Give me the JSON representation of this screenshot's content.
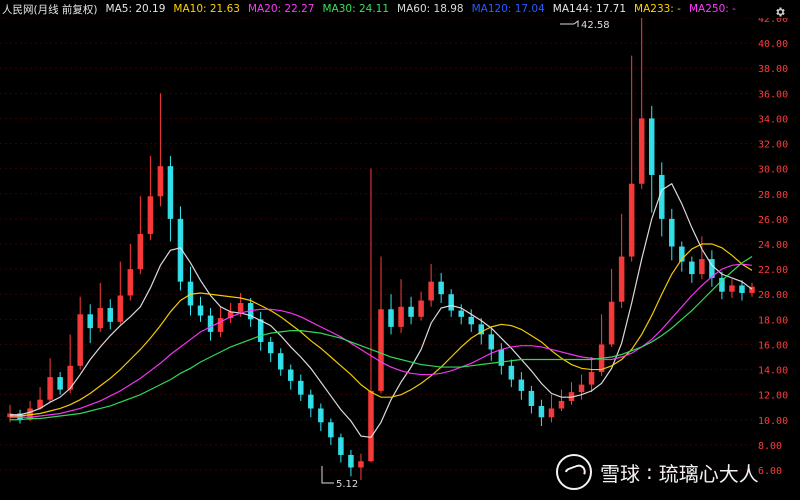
{
  "toolbar": {
    "title": "人民网(月线 前复权)",
    "ma": [
      {
        "label": "MA5: 20.19",
        "color": "#e6e6e6"
      },
      {
        "label": "MA10: 21.63",
        "color": "#ffd400"
      },
      {
        "label": "MA20: 22.27",
        "color": "#ff37ff"
      },
      {
        "label": "MA30: 24.11",
        "color": "#34e35a"
      },
      {
        "label": "MA60: 18.98",
        "color": "#d9d9d9"
      },
      {
        "label": "MA120: 17.04",
        "color": "#2b59ff"
      },
      {
        "label": "MA144: 17.71",
        "color": "#e6e6e6"
      },
      {
        "label": "MA233: -",
        "color": "#ffd400"
      },
      {
        "label": "MA250: -",
        "color": "#ff37ff"
      }
    ],
    "settings_icon": "settings-icon"
  },
  "y_axis": {
    "ticks": [
      "42.00",
      "40.00",
      "38.00",
      "36.00",
      "34.00",
      "32.00",
      "30.00",
      "28.00",
      "26.00",
      "24.00",
      "22.00",
      "20.00",
      "18.00",
      "16.00",
      "14.00",
      "12.00",
      "10.00",
      "8.00",
      "6.00"
    ]
  },
  "annotations": {
    "high": "42.58",
    "low": "5.12"
  },
  "watermark": {
    "brand": "雪球",
    "sep": ":",
    "author": "琉璃心大人"
  },
  "chart_data": {
    "type": "candlestick",
    "y_range": [
      6.0,
      42.0
    ],
    "colors": {
      "up": "#ff3b3b",
      "down": "#35e6ef",
      "ma5": "#e6e6e6",
      "ma10": "#ffd400",
      "ma20": "#ff37ff",
      "ma30": "#34e35a",
      "ma60": "#d9d9d9",
      "ma120": "#2b59ff",
      "ma144": "#e6e6e6",
      "ma233": "#ffd400",
      "ma250": "#ff37ff"
    },
    "candles": [
      [
        10.2,
        10.5,
        11.2,
        9.8
      ],
      [
        10.5,
        10.0,
        10.8,
        9.7
      ],
      [
        10.0,
        10.9,
        11.5,
        9.9
      ],
      [
        10.9,
        11.6,
        12.6,
        10.8
      ],
      [
        11.6,
        13.4,
        14.9,
        11.4
      ],
      [
        13.4,
        12.4,
        13.8,
        12.0
      ],
      [
        12.4,
        14.3,
        16.8,
        12.1
      ],
      [
        14.3,
        18.4,
        19.8,
        14.0
      ],
      [
        18.4,
        17.3,
        19.2,
        16.1
      ],
      [
        17.3,
        18.9,
        20.9,
        17.0
      ],
      [
        18.9,
        17.8,
        19.6,
        17.2
      ],
      [
        17.8,
        19.9,
        22.6,
        17.6
      ],
      [
        19.9,
        22.0,
        24.0,
        19.5
      ],
      [
        22.0,
        24.8,
        27.8,
        21.6
      ],
      [
        24.8,
        27.8,
        31.0,
        24.3
      ],
      [
        27.8,
        30.2,
        36.0,
        27.0
      ],
      [
        30.2,
        26.0,
        31.0,
        24.2
      ],
      [
        26.0,
        21.0,
        27.0,
        20.3
      ],
      [
        21.0,
        19.1,
        22.2,
        18.3
      ],
      [
        19.1,
        18.3,
        19.8,
        17.8
      ],
      [
        18.3,
        17.0,
        18.9,
        16.3
      ],
      [
        17.0,
        18.1,
        19.0,
        16.6
      ],
      [
        18.1,
        18.6,
        19.3,
        17.7
      ],
      [
        18.6,
        19.3,
        20.1,
        18.2
      ],
      [
        19.3,
        18.0,
        19.7,
        17.4
      ],
      [
        18.0,
        16.2,
        18.6,
        15.5
      ],
      [
        16.2,
        15.3,
        16.6,
        14.6
      ],
      [
        15.3,
        14.0,
        15.7,
        13.5
      ],
      [
        14.0,
        13.1,
        14.4,
        12.4
      ],
      [
        13.1,
        12.0,
        13.6,
        11.5
      ],
      [
        12.0,
        10.9,
        12.4,
        10.2
      ],
      [
        10.9,
        9.8,
        11.3,
        9.1
      ],
      [
        9.8,
        8.6,
        10.1,
        8.0
      ],
      [
        8.6,
        7.2,
        8.9,
        6.6
      ],
      [
        7.2,
        6.2,
        7.6,
        5.5
      ],
      [
        6.2,
        6.7,
        7.3,
        5.2
      ],
      [
        6.7,
        12.3,
        30.0,
        6.6
      ],
      [
        12.3,
        18.8,
        23.0,
        12.1
      ],
      [
        18.8,
        17.4,
        20.0,
        16.8
      ],
      [
        17.4,
        19.0,
        21.2,
        16.9
      ],
      [
        19.0,
        18.2,
        19.8,
        17.6
      ],
      [
        18.2,
        19.5,
        20.2,
        17.9
      ],
      [
        19.5,
        21.0,
        22.4,
        19.0
      ],
      [
        21.0,
        20.0,
        21.7,
        19.3
      ],
      [
        20.0,
        18.7,
        20.4,
        18.2
      ],
      [
        18.7,
        18.2,
        19.2,
        17.6
      ],
      [
        18.2,
        17.6,
        18.8,
        17.0
      ],
      [
        17.6,
        16.8,
        18.1,
        16.0
      ],
      [
        16.8,
        15.6,
        17.3,
        14.7
      ],
      [
        15.6,
        14.3,
        16.1,
        13.6
      ],
      [
        14.3,
        13.2,
        14.8,
        12.6
      ],
      [
        13.2,
        12.3,
        13.8,
        11.6
      ],
      [
        12.3,
        11.1,
        12.7,
        10.5
      ],
      [
        11.1,
        10.2,
        11.6,
        9.5
      ],
      [
        10.2,
        10.9,
        12.0,
        9.8
      ],
      [
        10.9,
        11.5,
        12.4,
        10.7
      ],
      [
        11.5,
        12.2,
        13.0,
        11.2
      ],
      [
        12.2,
        12.8,
        13.6,
        11.6
      ],
      [
        12.8,
        13.8,
        15.0,
        12.2
      ],
      [
        13.8,
        16.0,
        18.4,
        13.5
      ],
      [
        16.0,
        19.4,
        22.0,
        15.8
      ],
      [
        19.4,
        23.0,
        26.4,
        18.9
      ],
      [
        23.0,
        28.8,
        39.0,
        22.6
      ],
      [
        28.8,
        34.0,
        42.6,
        28.4
      ],
      [
        34.0,
        29.5,
        35.0,
        26.5
      ],
      [
        29.5,
        26.0,
        30.5,
        24.6
      ],
      [
        26.0,
        23.8,
        26.8,
        22.7
      ],
      [
        23.8,
        22.6,
        24.2,
        21.8
      ],
      [
        22.6,
        21.6,
        23.0,
        20.9
      ],
      [
        21.6,
        22.8,
        24.6,
        21.2
      ],
      [
        22.8,
        21.3,
        23.5,
        20.6
      ],
      [
        21.3,
        20.2,
        21.8,
        19.6
      ],
      [
        20.2,
        20.7,
        21.2,
        19.7
      ],
      [
        20.7,
        20.1,
        21.1,
        19.5
      ],
      [
        20.1,
        20.6,
        20.9,
        19.8
      ]
    ],
    "ma": {
      "ma5": [
        10.4,
        10.4,
        10.6,
        10.9,
        11.4,
        11.8,
        12.5,
        13.6,
        14.8,
        15.8,
        16.7,
        17.5,
        18.2,
        19.0,
        20.5,
        22.3,
        23.5,
        23.7,
        22.5,
        21.1,
        19.9,
        19.0,
        18.6,
        18.5,
        18.3,
        17.9,
        17.5,
        16.7,
        15.8,
        15.0,
        14.1,
        13.0,
        11.9,
        10.8,
        9.9,
        8.7,
        8.6,
        9.8,
        11.6,
        13.0,
        14.2,
        15.6,
        17.7,
        18.9,
        19.1,
        18.9,
        18.4,
        17.9,
        17.3,
        16.5,
        15.7,
        14.8,
        13.9,
        12.9,
        12.1,
        11.8,
        11.8,
        12.0,
        12.3,
        12.9,
        14.1,
        16.1,
        19.3,
        22.8,
        26.0,
        28.3,
        28.8,
        27.2,
        25.3,
        23.6,
        22.3,
        21.6,
        21.3,
        21.0,
        20.4
      ],
      "ma10": [
        10.3,
        10.3,
        10.4,
        10.5,
        10.7,
        10.9,
        11.2,
        11.6,
        12.1,
        12.7,
        13.3,
        14.0,
        14.8,
        15.6,
        16.5,
        17.5,
        18.6,
        19.5,
        20.0,
        20.1,
        20.0,
        19.9,
        19.8,
        19.7,
        19.5,
        19.1,
        18.7,
        18.2,
        17.6,
        17.0,
        16.3,
        15.7,
        15.0,
        14.3,
        13.6,
        12.8,
        12.2,
        11.8,
        11.8,
        12.0,
        12.4,
        12.9,
        13.5,
        14.2,
        15.0,
        15.8,
        16.5,
        17.0,
        17.4,
        17.6,
        17.5,
        17.2,
        16.7,
        16.2,
        15.5,
        14.9,
        14.4,
        14.1,
        14.0,
        14.0,
        14.3,
        14.8,
        15.6,
        16.8,
        18.3,
        20.0,
        21.6,
        22.8,
        23.6,
        24.0,
        24.0,
        23.7,
        23.1,
        22.4,
        21.9
      ],
      "ma20": [
        10.2,
        10.2,
        10.2,
        10.3,
        10.4,
        10.5,
        10.7,
        10.9,
        11.2,
        11.5,
        11.9,
        12.3,
        12.8,
        13.3,
        13.9,
        14.5,
        15.2,
        15.8,
        16.4,
        17.0,
        17.4,
        17.8,
        18.2,
        18.5,
        18.7,
        18.8,
        18.8,
        18.7,
        18.5,
        18.2,
        17.8,
        17.4,
        17.0,
        16.6,
        16.1,
        15.6,
        15.1,
        14.6,
        14.2,
        13.9,
        13.7,
        13.6,
        13.6,
        13.7,
        13.9,
        14.2,
        14.5,
        14.9,
        15.3,
        15.6,
        15.8,
        15.9,
        15.9,
        15.8,
        15.6,
        15.4,
        15.2,
        15.0,
        14.9,
        14.8,
        14.8,
        15.0,
        15.3,
        15.8,
        16.4,
        17.2,
        18.1,
        19.0,
        19.9,
        20.7,
        21.4,
        22.0,
        22.3,
        22.4,
        22.3
      ],
      "ma30": [
        10.0,
        10.0,
        10.1,
        10.1,
        10.2,
        10.3,
        10.4,
        10.5,
        10.7,
        10.9,
        11.1,
        11.4,
        11.7,
        12.0,
        12.4,
        12.8,
        13.2,
        13.7,
        14.1,
        14.6,
        15.0,
        15.4,
        15.8,
        16.1,
        16.4,
        16.7,
        16.9,
        17.0,
        17.1,
        17.1,
        17.0,
        16.9,
        16.7,
        16.5,
        16.2,
        15.9,
        15.6,
        15.3,
        15.0,
        14.8,
        14.6,
        14.4,
        14.3,
        14.2,
        14.2,
        14.2,
        14.3,
        14.4,
        14.5,
        14.6,
        14.7,
        14.8,
        14.8,
        14.8,
        14.8,
        14.8,
        14.8,
        14.8,
        14.8,
        14.9,
        15.0,
        15.2,
        15.5,
        15.8,
        16.2,
        16.7,
        17.3,
        18.0,
        18.7,
        19.5,
        20.3,
        21.1,
        21.8,
        22.5,
        23.0
      ]
    }
  }
}
